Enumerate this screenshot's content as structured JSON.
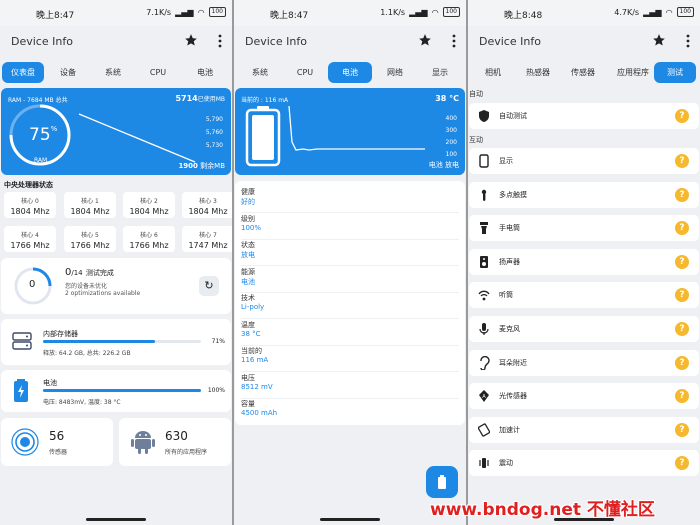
{
  "status": {
    "s1": {
      "time": "晚上8:47",
      "speed": "7.1K/s",
      "battery": "100"
    },
    "s2": {
      "time": "晚上8:47",
      "speed": "1.1K/s",
      "battery": "100"
    },
    "s3": {
      "time": "晚上8:48",
      "speed": "4.7K/s",
      "battery": "100"
    }
  },
  "app": {
    "title": "Device Info"
  },
  "tabs_s1": [
    {
      "label": "仪表盘",
      "active": true
    },
    {
      "label": "设备"
    },
    {
      "label": "系统"
    },
    {
      "label": "CPU"
    },
    {
      "label": "电池"
    }
  ],
  "tabs_s2": [
    {
      "label": "系统"
    },
    {
      "label": "CPU"
    },
    {
      "label": "电池",
      "active": true
    },
    {
      "label": "网络"
    },
    {
      "label": "显示"
    }
  ],
  "tabs_s3": [
    {
      "label": "相机"
    },
    {
      "label": "热感器"
    },
    {
      "label": "传感器"
    },
    {
      "label": "应用程序"
    },
    {
      "label": "测试",
      "active": true
    }
  ],
  "ram": {
    "label": "RAM - 7684 MB 总共",
    "used_value": "5714",
    "used_suffix": "已使用MB",
    "percent": "75",
    "percent_sign": "%",
    "gauge_label": "RAM",
    "axis": [
      "5,790",
      "5,760",
      "5,730"
    ],
    "free_value": "1900",
    "free_suffix": "剩余MB",
    "gauge_fraction": 0.75
  },
  "cpu": {
    "title": "中央处理器状态",
    "cores": [
      {
        "label": "核心 0",
        "value": "1804 Mhz"
      },
      {
        "label": "核心 1",
        "value": "1804 Mhz"
      },
      {
        "label": "核心 2",
        "value": "1804 Mhz"
      },
      {
        "label": "核心 3",
        "value": "1804 Mhz"
      },
      {
        "label": "核心 4",
        "value": "1766 Mhz"
      },
      {
        "label": "核心 5",
        "value": "1766 Mhz"
      },
      {
        "label": "核心 6",
        "value": "1766 Mhz"
      },
      {
        "label": "核心 7",
        "value": "1747 Mhz"
      }
    ]
  },
  "optim": {
    "circle_value": "0",
    "done_count": "0",
    "done_total": "/14",
    "done_label": "测试完成",
    "line1": "您的设备未优化",
    "line2": "2 optimizations available"
  },
  "storage": {
    "title": "内部存储器",
    "percent": "71%",
    "detail": "释放: 64.2 GB, 总共: 226.2 GB",
    "fraction": 0.71
  },
  "battery": {
    "title": "电池",
    "percent": "100%",
    "detail": "电压: 8483mV, 温度: 38 °C",
    "fraction": 1.0
  },
  "sensors": {
    "count": "56",
    "label": "传感器"
  },
  "apps": {
    "count": "630",
    "label": "所有的应用程序"
  },
  "batt_chart": {
    "current_label": "当前的 : 116 mA",
    "temp": "38 °C",
    "axis": [
      "400",
      "300",
      "200",
      "100"
    ],
    "legend1": "电池",
    "legend2": "放电"
  },
  "battery_props": [
    {
      "label": "健康",
      "value": "好的"
    },
    {
      "label": "级别",
      "value": "100%"
    },
    {
      "label": "状态",
      "value": "放电"
    },
    {
      "label": "能源",
      "value": "电池"
    },
    {
      "label": "技术",
      "value": "Li-poly"
    },
    {
      "label": "温度",
      "value": "38 °C"
    },
    {
      "label": "当前的",
      "value": "116 mA"
    },
    {
      "label": "电压",
      "value": "8512 mV"
    },
    {
      "label": "容量",
      "value": "4500 mAh"
    }
  ],
  "tests": {
    "auto_title": "自动",
    "interactive_title": "互动",
    "auto_items": [
      {
        "name": "自动测试",
        "icon": "shield-icon"
      }
    ],
    "items": [
      {
        "name": "显示",
        "icon": "phone-icon"
      },
      {
        "name": "多点触摸",
        "icon": "touch-icon"
      },
      {
        "name": "手电筒",
        "icon": "flashlight-icon"
      },
      {
        "name": "扬声器",
        "icon": "speaker-icon"
      },
      {
        "name": "听筒",
        "icon": "earpiece-icon"
      },
      {
        "name": "麦克风",
        "icon": "microphone-icon"
      },
      {
        "name": "耳朵附近",
        "icon": "ear-icon"
      },
      {
        "name": "光传感器",
        "icon": "light-sensor-icon"
      },
      {
        "name": "加速计",
        "icon": "accelerometer-icon"
      },
      {
        "name": "震动",
        "icon": "vibrate-icon"
      }
    ],
    "help_glyph": "?"
  },
  "watermark": {
    "text": "www.bndog.net 不懂社区"
  },
  "colors": {
    "accent": "#1e88e5",
    "help": "#f6b82c"
  }
}
